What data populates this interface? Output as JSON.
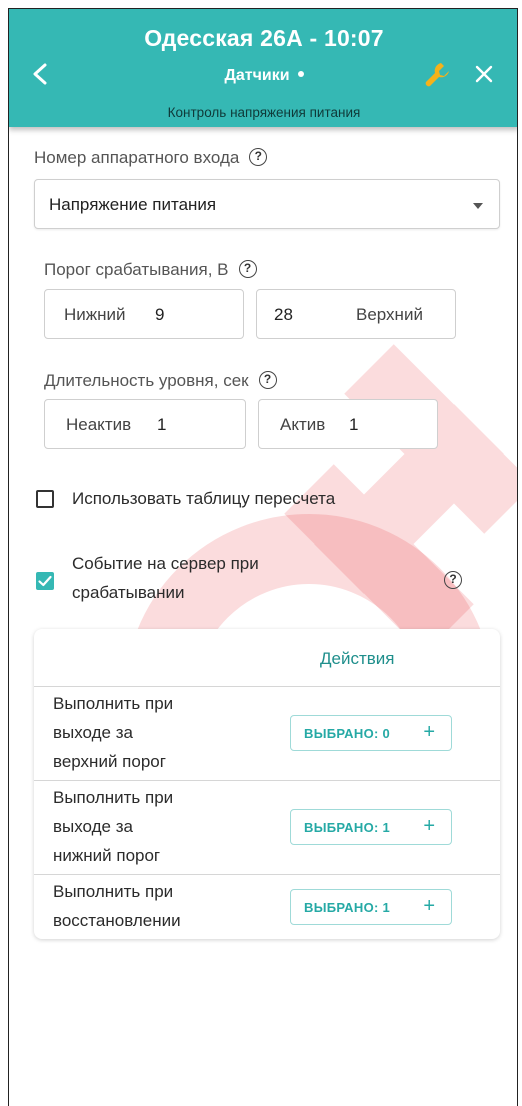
{
  "header": {
    "title": "Одесская 26А - 10:07",
    "section": "Датчики",
    "subtitle": "Контроль напряжения питания",
    "accent_color": "#35b8b4",
    "icons": [
      "back-chevron-icon",
      "wrench-icon",
      "close-icon"
    ]
  },
  "input_number": {
    "label": "Номер аппаратного входа",
    "selected": "Напряжение питания"
  },
  "threshold": {
    "label": "Порог срабатывания, В",
    "lower_label": "Нижний",
    "lower_value": "9",
    "upper_value": "28",
    "upper_label": "Верхний"
  },
  "duration": {
    "label": "Длительность уровня, сек",
    "inactive_label": "Неактив",
    "inactive_value": "1",
    "active_label": "Актив",
    "active_value": "1"
  },
  "options": {
    "use_table_label": "Использовать таблицу пересчета",
    "use_table_checked": false,
    "event_label_line1": "Событие на сервер при",
    "event_label_line2": "срабатывании",
    "event_checked": true
  },
  "actions_card": {
    "header": "Действия",
    "rows": [
      {
        "lines": [
          "Выполнить при",
          "выходе за",
          "верхний порог"
        ],
        "button": "ВЫБРАНО: 0"
      },
      {
        "lines": [
          "Выполнить при",
          "выходе за",
          "нижний порог"
        ],
        "button": "ВЫБРАНО: 1"
      },
      {
        "lines": [
          "Выполнить при",
          "восстановлении"
        ],
        "button": "ВЫБРАНО: 1"
      }
    ]
  },
  "help_glyph": "?",
  "plus_glyph": "+"
}
